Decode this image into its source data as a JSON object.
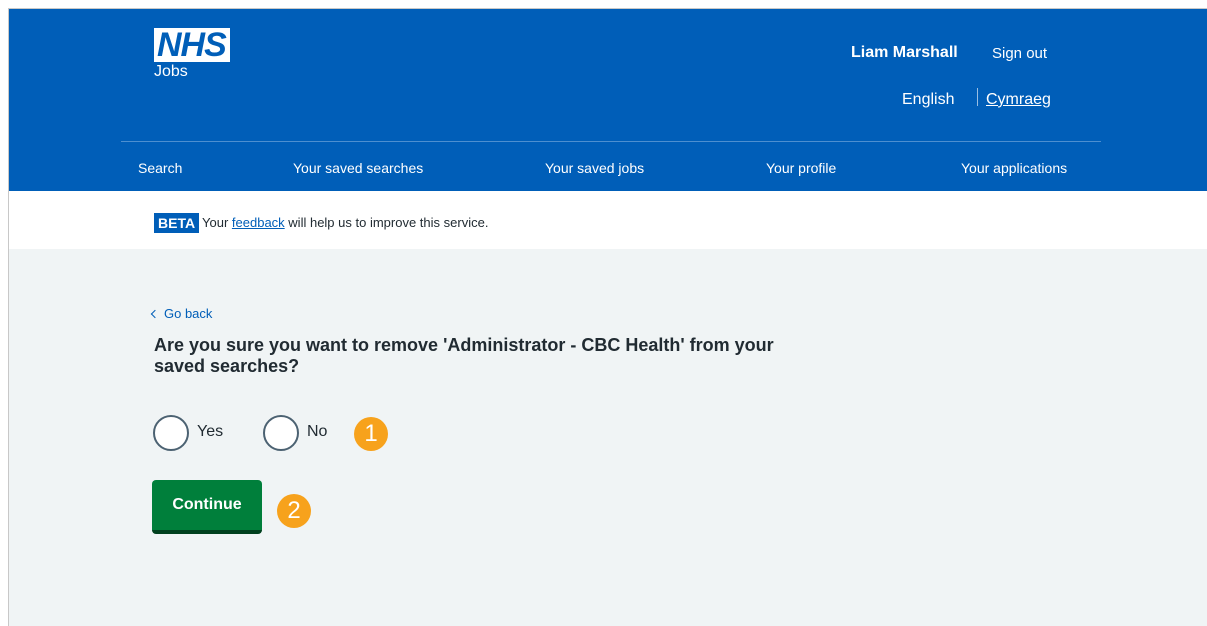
{
  "header": {
    "logo_text": "NHS",
    "logo_subtitle": "Jobs",
    "user_name": "Liam Marshall",
    "sign_out_label": "Sign out",
    "language_current": "English",
    "language_alt": "Cymraeg"
  },
  "nav": {
    "items": [
      {
        "label": "Search"
      },
      {
        "label": "Your saved searches"
      },
      {
        "label": "Your saved jobs"
      },
      {
        "label": "Your profile"
      },
      {
        "label": "Your applications"
      }
    ]
  },
  "beta": {
    "tag": "BETA",
    "text_before": "Your",
    "link_label": "feedback",
    "text_after": "will help us to improve this service."
  },
  "main": {
    "back_label": "Go back",
    "question": "Are you sure you want to remove 'Administrator - CBC Health' from your saved searches?",
    "options": [
      {
        "label": "Yes",
        "selected": false
      },
      {
        "label": "No",
        "selected": false
      }
    ],
    "continue_label": "Continue"
  },
  "annotations": {
    "step_1": "1",
    "step_2": "2"
  },
  "colors": {
    "header_blue": "#005eb8",
    "button_green": "#007f3b",
    "annotation_orange": "#f7a21c",
    "page_background": "#f0f4f5"
  }
}
